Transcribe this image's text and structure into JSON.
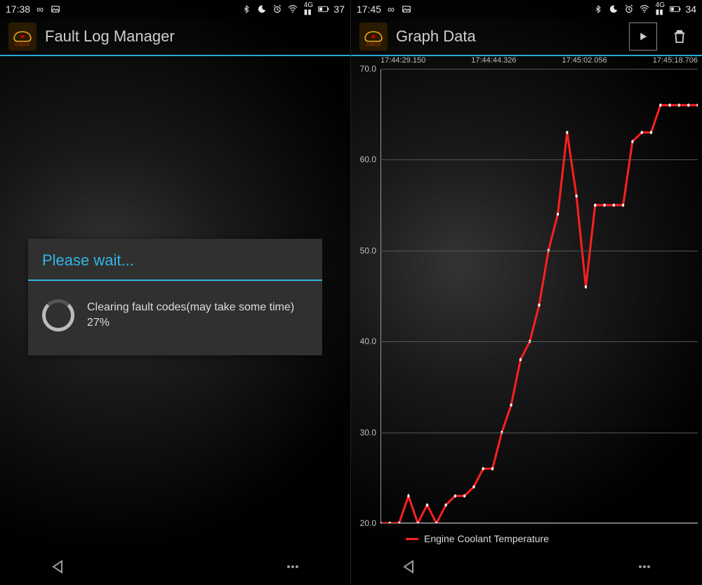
{
  "left": {
    "status": {
      "time": "17:38",
      "battery": "37"
    },
    "appbar": {
      "title": "Fault Log Manager"
    },
    "dialog": {
      "title": "Please wait...",
      "message": "Clearing fault codes(may take some time) 27%"
    }
  },
  "right": {
    "status": {
      "time": "17:45",
      "battery": "34"
    },
    "appbar": {
      "title": "Graph Data"
    },
    "legend": {
      "series_name": "Engine Coolant Temperature"
    }
  },
  "chart_data": {
    "type": "line",
    "title": "",
    "xlabel": "",
    "ylabel": "",
    "ylim": [
      20,
      70
    ],
    "x_tick_labels": [
      "17:44:29.150",
      "17:44:44.326",
      "17:45:02.056",
      "17:45:18.706"
    ],
    "y_ticks": [
      20,
      30,
      40,
      50,
      60,
      70
    ],
    "series": [
      {
        "name": "Engine Coolant Temperature",
        "color": "#ff2020",
        "values": [
          20,
          20,
          20,
          23,
          20,
          22,
          20,
          22,
          23,
          23,
          24,
          26,
          26,
          30,
          33,
          38,
          40,
          44,
          50,
          54,
          63,
          56,
          46,
          55,
          55,
          55,
          55,
          62,
          63,
          63,
          66,
          66,
          66,
          66,
          66
        ]
      }
    ]
  }
}
